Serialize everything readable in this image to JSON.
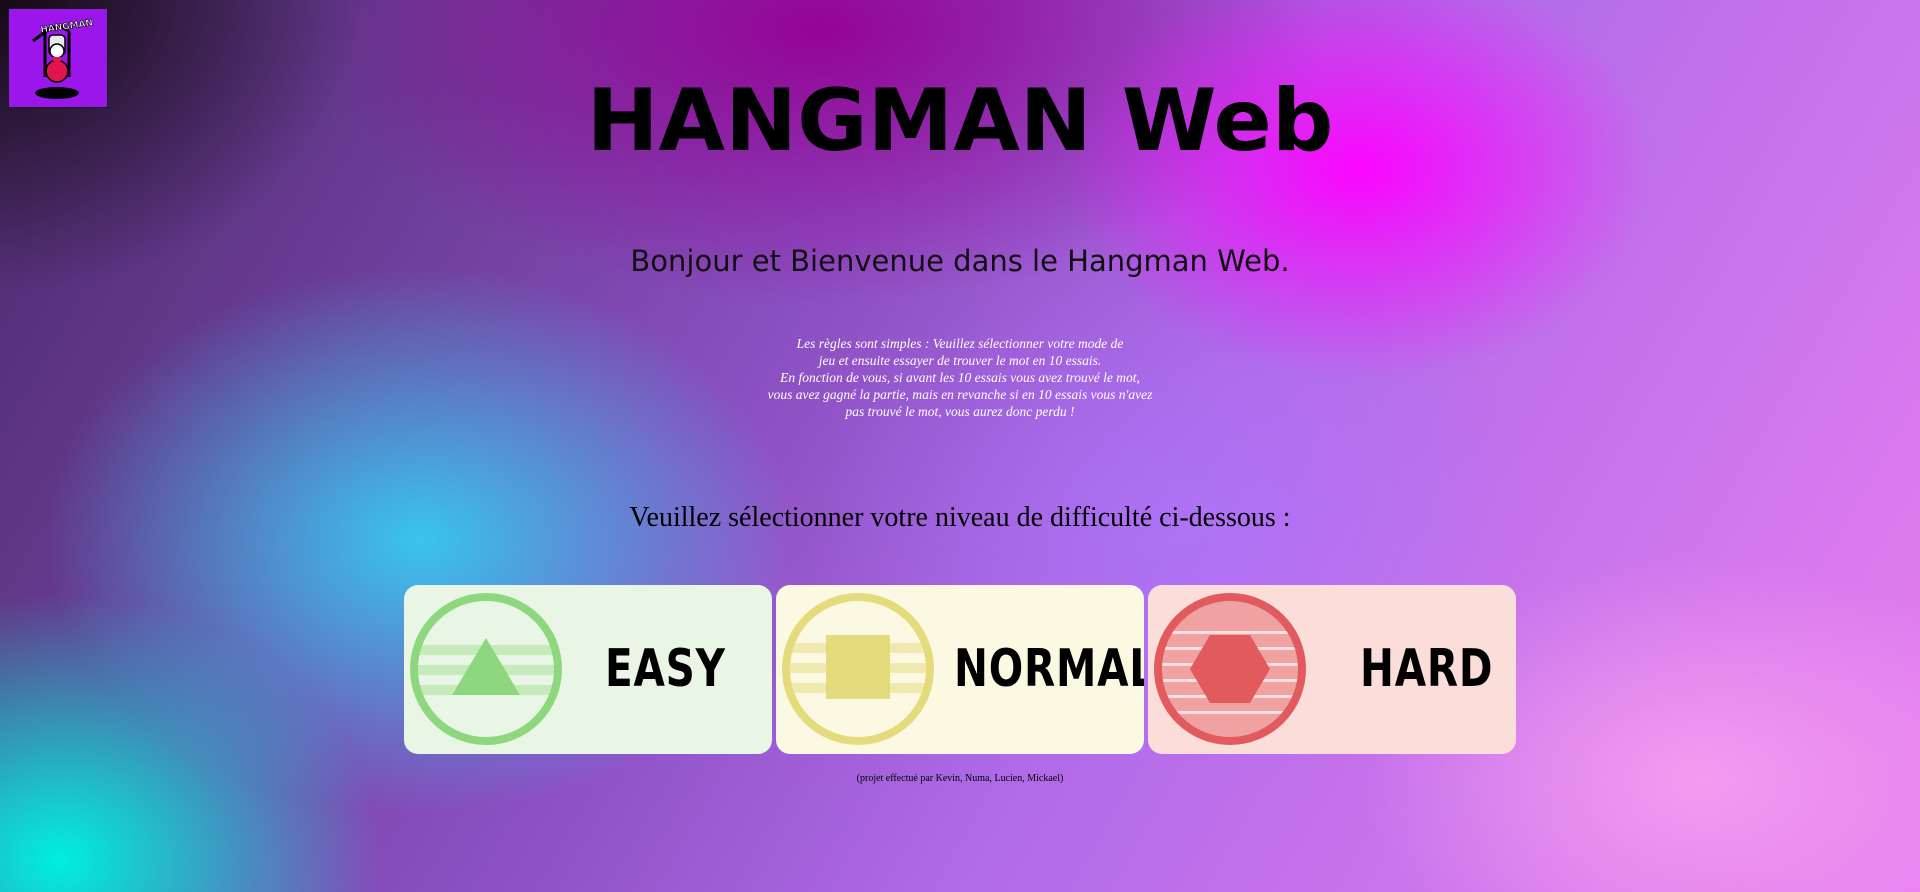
{
  "page": {
    "title": "HANGMAN Web",
    "welcome": "Bonjour et Bienvenue dans le Hangman Web.",
    "rules_lines": [
      "Les règles sont simples : Veuillez sélectionner votre mode de",
      "jeu et ensuite essayer de trouver le mot en 10 essais.",
      "En fonction de vous, si avant les 10 essais vous avez trouvé le mot,",
      "vous avez gagné la partie, mais en revanche si en 10 essais vous n'avez",
      "pas trouvé le mot, vous aurez donc perdu !"
    ],
    "difficulty_prompt": "Veuillez sélectionner votre niveau de difficulté ci-dessous :",
    "credits": "(projet effectué par Kevin, Numa, Lucien, Mickael)"
  },
  "logo": {
    "text": "HANGMAN",
    "background": "#9b16ea",
    "icon": "hangman-logo-icon"
  },
  "difficulties": [
    {
      "label": "EASY",
      "icon": "triangle-icon",
      "color": "#8fd77f",
      "background": "#e9f6e5"
    },
    {
      "label": "NORMAL",
      "icon": "square-icon",
      "color": "#e3db7c",
      "background": "#fbf9e2"
    },
    {
      "label": "HARD",
      "icon": "hexagon-icon",
      "color": "#e05a5e",
      "background": "#fbddd9"
    }
  ]
}
